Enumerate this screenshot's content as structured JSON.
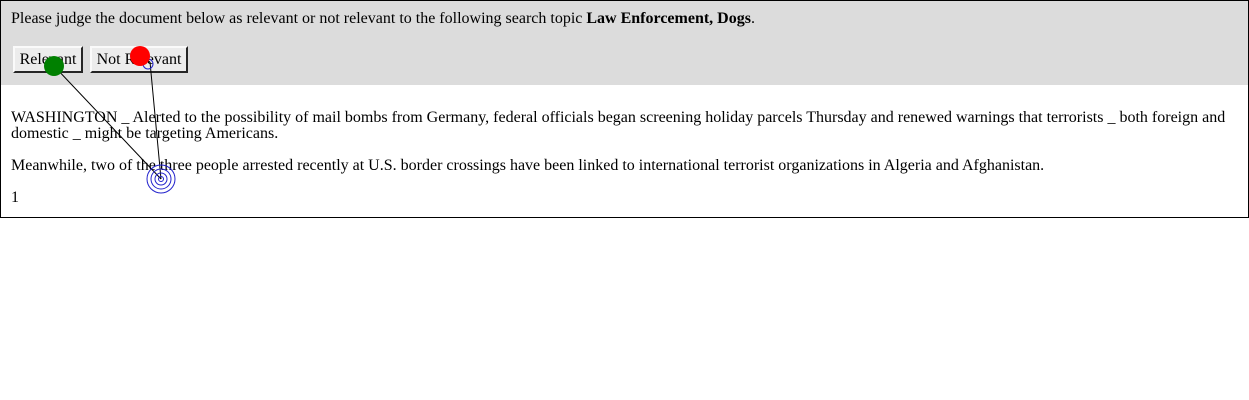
{
  "prompt": {
    "text": "Please judge the document below as relevant or not relevant to the following search topic ",
    "topic": "Law Enforcement, Dogs",
    "period": "."
  },
  "buttons": {
    "relevant": "Relevant",
    "not_relevant": "Not Relevant"
  },
  "document": {
    "paragraphs": [
      "WASHINGTON _ Alerted to the possibility of mail bombs from Germany, federal officials began screening holiday parcels Thursday and renewed warnings that terrorists _ both foreign and domestic _ might be targeting Americans.",
      "Meanwhile, two of the three people arrested recently at U.S. border crossings have been linked to international terrorist organizations in Algeria and Afghanistan.",
      "1"
    ]
  },
  "overlay": {
    "start_marker_color": "#008000",
    "end_marker_color": "#ff0000",
    "fixation_color": "#2222cc",
    "path_color": "#000000"
  }
}
